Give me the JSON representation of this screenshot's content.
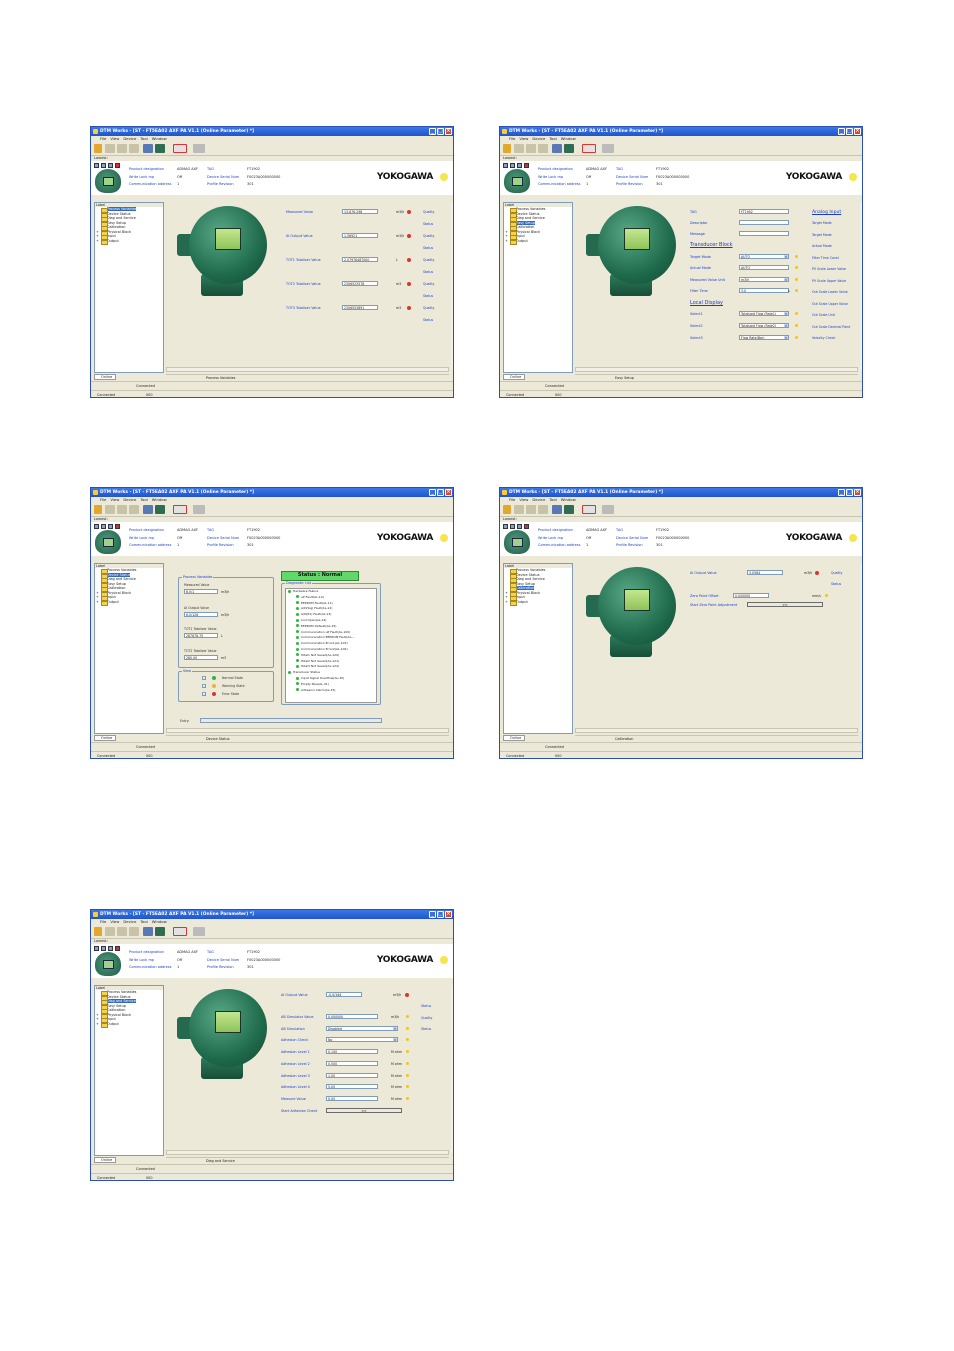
{
  "window": {
    "title": "DTM Works - [ST - FT5EA02 AXF PA V1.1 (Online Parameter) *]",
    "menus": [
      "File",
      "View",
      "Device",
      "Tool",
      "Window"
    ],
    "lowest": "Lowest:",
    "online": "Online",
    "connected": "Connected",
    "connected2": "Connected",
    "connected_value": "000",
    "logo": "YOKOGAWA"
  },
  "device_info": {
    "product_designation_label": "Product designation",
    "product_designation": "ADMAG AXF",
    "write_lock_label": "Write Lock mp",
    "write_lock": "Off",
    "comm_addr_label": "Communication address",
    "comm_addr": "1",
    "tag_label": "TAG",
    "tag": "FT1902",
    "serial_label": "Device Serial Num",
    "serial": "F0023A000000000",
    "profile_label": "Profile Revision",
    "profile": "301"
  },
  "tree": {
    "header": "Label",
    "items": [
      "Process Variables",
      "Device Status",
      "Diag and Service",
      "Easy Setup",
      "Calibration",
      "Physical Block",
      "Input",
      "Output"
    ]
  },
  "quality": "Quality",
  "status": "Status",
  "screens": [
    {
      "title": "DTM Works - [ST - FT5EA02 AXF PA V1.1 (Online Parameter) *]",
      "status": "Process Variables",
      "selected": 0,
      "rows": [
        {
          "label": "Measured Value",
          "value": "13.876.298",
          "unit": "m3/h"
        },
        {
          "label": "AI Output Value",
          "value": "1.56921",
          "unit": "m3/h"
        },
        {
          "label": "TOT1 Totalizer Value",
          "value": "2.07976487000",
          "unit": "L"
        },
        {
          "label": "TOT2 Totalizer Value",
          "value": "2306523578",
          "unit": "m3"
        },
        {
          "label": "TOT3 Totalizer Value",
          "value": "2306553891",
          "unit": "m3"
        }
      ]
    },
    {
      "title": "DTM Works - [ST - FT5EA02 AXF PA V1.1 (Online Parameter) *]",
      "status": "Easy Setup",
      "selected": 3,
      "tag_label": "TAG",
      "tag_value": "FT1902",
      "descriptor_label": "Descriptor",
      "message_label": "Message",
      "transducer_header": "Transducer Block",
      "target_label": "Target Mode",
      "target_value": "AUTO",
      "actual_label": "Actual Mode",
      "actual_value": "AUTO",
      "mvu_label": "Measured Value Unit",
      "mvu_value": "m3/h",
      "filter_label": "Filter Time",
      "filter_value": "3.0",
      "filter_unit": "s",
      "local_header": "Local Display",
      "sel1_label": "Select1",
      "sel1_value": "Totalized Flow (Rate1)",
      "sel2_label": "Select2",
      "sel2_value": "Totalized Flow (Rate2)",
      "sel3_label": "Select3",
      "sel3_value": "Flow Rate(Bar)",
      "ai_header": "Analog Input",
      "ai_items": [
        "Target Mode",
        "Target Mode",
        "Actual Mode",
        "Filter Time Const",
        "PV Scale Lower Value",
        "PV Scale Upper Value",
        "Out Scale Lower Value",
        "Out Scale Upper Value",
        "Out Scale Unit",
        "Out Scale Decimal Point",
        "Velocity Check"
      ]
    },
    {
      "title": "DTM Works - [ST - FT5EA02 AXF PA V1.1 (Online Parameter) *]",
      "status": "Device Status",
      "selected": 1,
      "pv_group": "Process Variables",
      "mv_label": "Measured Value",
      "mv_value": "6.0/1",
      "mv_unit": "m3/h",
      "ai_label": "AI Output Value",
      "ai_value": "6.0/126",
      "ai_unit": "m3/h",
      "tot1_label": "TOT1 Totalizer Value",
      "tot1_value": "287878.70",
      "tot1_unit": "L",
      "tot2_label": "TOT2 Totalizer Value",
      "tot2_value": "280.00",
      "tot2_unit": "m3",
      "view_group": "View",
      "view_items": [
        "Normal State",
        "Warning State",
        "Error State"
      ],
      "status_title": "Status : Normal",
      "diag_title": "Diagnostic List",
      "diag_items": [
        "Hardware Failure",
        "uP Fault(AL-10)",
        "EEPROM Fault(AL-11)",
        "A/D(Sig) Fault(AL-12)",
        "A/D(Ex) Fault(AL-13)",
        "Coil Open(AL-14)",
        "EEPROM Default(AL-15)",
        "Communication uP Fault(AL-100)",
        "Communication EEPROM Fault(AL-...",
        "Communication Error1(AL-103)",
        "Communication Error2(AL-104)",
        "Total1 Not Saved(AL-120)",
        "Total2 Not Saved(AL-121)",
        "Total3 Not Saved(AL-122)",
        "Transducer Status",
        "Input Signal Overflow(AL-30)",
        "Empty Pipe(AL-31)",
        "Adhesion Alarm(AL-33)"
      ],
      "entry_label": "Entry:"
    },
    {
      "title": "DTM Works - [ST - FT5EA02 AXF PA V1.1 (Online Parameter) *]",
      "status": "Calibration",
      "selected": 4,
      "ai_label": "AI Output Value",
      "ai_value": "3.0564",
      "ai_unit": "m3/h",
      "zero_label": "Zero Point Offset",
      "zero_value": "0.000000",
      "zero_unit": "mm/s",
      "start_label": "Start Zero Point Adjustment",
      "btn": ">>"
    },
    {
      "title": "DTM Works - [ST - FT5EA02 AXF PA V1.1 (Online Parameter) *]",
      "status": "Diag and Service",
      "selected": 2,
      "ai_label": "AI Output Value",
      "ai_value": "-0.0/164",
      "ai_unit": "m3/h",
      "rows": [
        {
          "label": "AB Simulator Value",
          "value": "0.000000",
          "unit": "m3/h"
        },
        {
          "label": "AB Simulation",
          "value": "Disabled",
          "unit": ""
        },
        {
          "label": "Adhesion Check",
          "value": "No",
          "unit": ""
        },
        {
          "label": "Adhesion Level 1",
          "value": "0.100",
          "unit": "M ohm"
        },
        {
          "label": "Adhesion Level 2",
          "value": "0.500",
          "unit": "M ohm"
        },
        {
          "label": "Adhesion Level 3",
          "value": "1.00",
          "unit": "M ohm"
        },
        {
          "label": "Adhesion Level 4",
          "value": "5.00",
          "unit": "M ohm"
        },
        {
          "label": "Measure Value",
          "value": "0.00",
          "unit": "M ohm"
        }
      ],
      "start_label": "Start Adhesion Check",
      "btn": ">>"
    }
  ]
}
